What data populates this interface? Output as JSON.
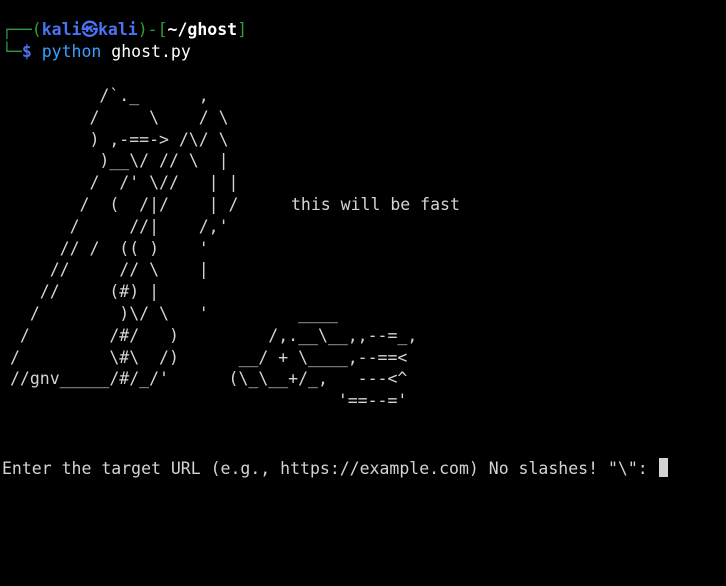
{
  "prompt": {
    "frame_left": "┌──(",
    "user": "kali㉿kali",
    "frame_mid": ")-[",
    "path": "~/ghost",
    "frame_right": "]",
    "frame_bottom": "└─",
    "dollar": "$",
    "command": "python",
    "argument": "ghost.py"
  },
  "ascii_art": "         /`._      ,\n        /     \\    / \\\n        ) ,-==-> /\\/ \\\n         )__\\/ // \\  |\n        /  /' \\//   | |\n       /  (  /|/    | /\n      /     //|    /,'\n     // /  (( )    '\n    //     // \\    |\n   //     (#) |\n  /        )\\/ \\   '         ____\n /        /#/   )         /,.__\\__,,--=_,\n/         \\#\\  /)      __/ + \\____,--==<\n//gnv_____/#/_/'      (\\_\\__+/_,   ---<^\n                                 '==--='",
  "caption": "this will be fast",
  "input_prompt": "Enter the target URL (e.g., https://example.com) No slashes! \"\\\": "
}
